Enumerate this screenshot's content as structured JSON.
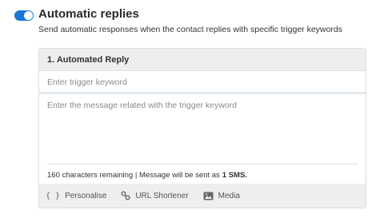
{
  "section": {
    "title": "Automatic replies",
    "subtitle": "Send automatic responses when the contact replies with specific trigger keywords",
    "toggle_on": true
  },
  "reply_card": {
    "header": "1. Automated Reply",
    "keyword_placeholder": "Enter trigger keyword",
    "message_placeholder": "Enter the message related with the trigger keyword",
    "counter": {
      "text": "160 characters remaining | Message will be sent as",
      "count": "1 SMS."
    }
  },
  "toolbar": {
    "personalise": {
      "icon": "braces-icon",
      "label": "Personalise"
    },
    "url_shortener": {
      "icon": "link-icon",
      "label": "URL Shortener"
    },
    "media": {
      "icon": "image-icon",
      "label": "Media"
    }
  },
  "colors": {
    "accent": "#1976d2",
    "header_bg": "#eeeeee"
  }
}
